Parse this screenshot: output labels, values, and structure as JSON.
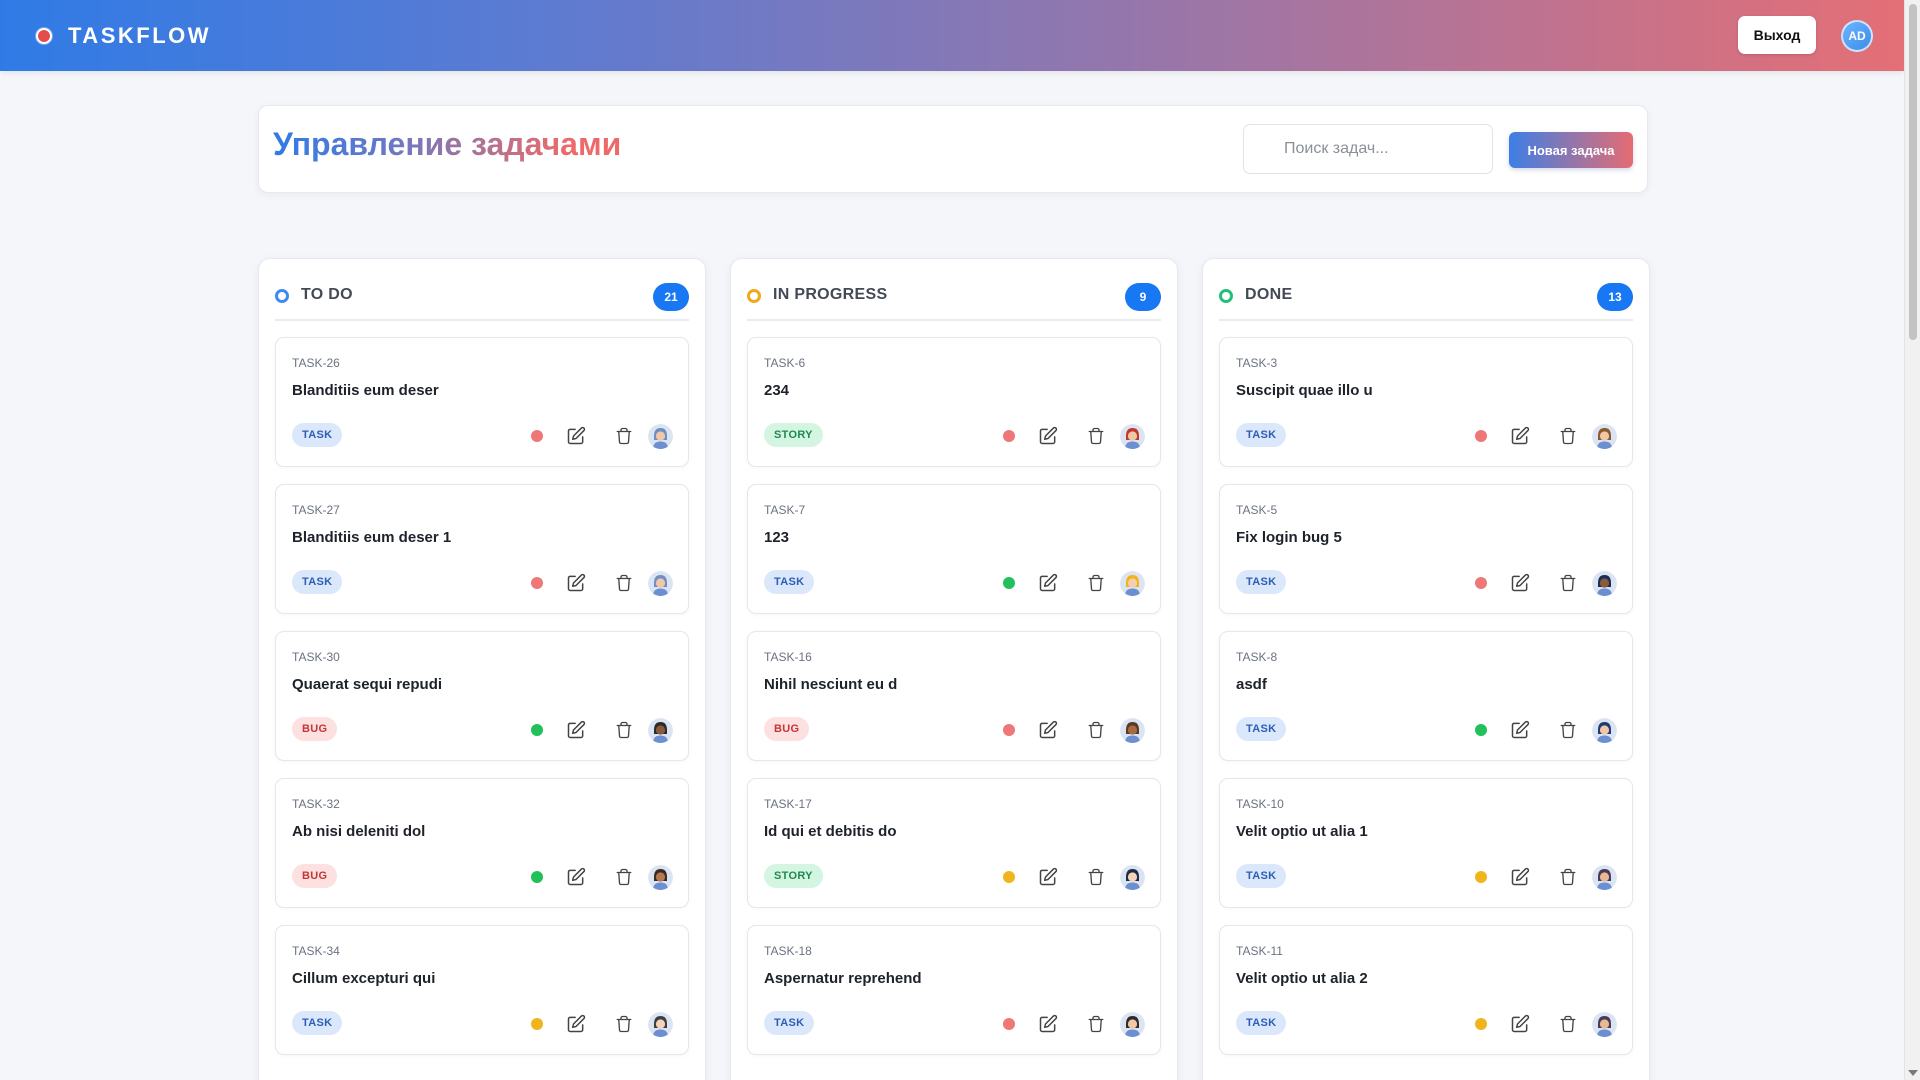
{
  "header": {
    "brand": "TASKFLOW",
    "logout_label": "Выход",
    "user_initials": "AD"
  },
  "toolbar": {
    "page_title": "Управление задачами",
    "search_placeholder": "Поиск задач...",
    "new_task_label": "Новая задача"
  },
  "colors": {
    "accent_blue": "#1877f2",
    "todo_dot": "#3d8bf0",
    "in_progress_dot": "#f0a81c",
    "done_dot": "#22c07a",
    "priority_high": "#ef7777",
    "priority_medium": "#f0b41c",
    "priority_low": "#22c05a"
  },
  "columns": [
    {
      "title": "TO DO",
      "count": "21",
      "dot_color": "#3d8bf0",
      "cards": [
        {
          "id": "TASK-26",
          "title": "Blanditiis eum deser",
          "tag": "TASK",
          "priority": "high",
          "avatar": {
            "skin": "#f2c7a5",
            "hair": "#6e8fc4"
          }
        },
        {
          "id": "TASK-27",
          "title": "Blanditiis eum deser 1",
          "tag": "TASK",
          "priority": "high",
          "avatar": {
            "skin": "#f2c7a5",
            "hair": "#6e8fc4"
          }
        },
        {
          "id": "TASK-30",
          "title": "Quaerat sequi repudi",
          "tag": "BUG",
          "priority": "low",
          "avatar": {
            "skin": "#8a5a3b",
            "hair": "#2b2b2b"
          }
        },
        {
          "id": "TASK-32",
          "title": "Ab nisi deleniti dol",
          "tag": "BUG",
          "priority": "low",
          "avatar": {
            "skin": "#b57a52",
            "hair": "#3a2a20"
          }
        },
        {
          "id": "TASK-34",
          "title": "Cillum excepturi qui",
          "tag": "TASK",
          "priority": "medium",
          "avatar": {
            "skin": "#f5d3b8",
            "hair": "#3d3d3d"
          }
        }
      ]
    },
    {
      "title": "IN PROGRESS",
      "count": "9",
      "dot_color": "#f0a81c",
      "cards": [
        {
          "id": "TASK-6",
          "title": "234",
          "tag": "STORY",
          "priority": "high",
          "avatar": {
            "skin": "#f2c7a5",
            "hair": "#c0392b"
          }
        },
        {
          "id": "TASK-7",
          "title": "123",
          "tag": "TASK",
          "priority": "low",
          "avatar": {
            "skin": "#f7cfae",
            "hair": "#f0b31c"
          }
        },
        {
          "id": "TASK-16",
          "title": "Nihil nesciunt eu d",
          "tag": "BUG",
          "priority": "high",
          "avatar": {
            "skin": "#a86a42",
            "hair": "#5a3a22"
          }
        },
        {
          "id": "TASK-17",
          "title": "Id qui et debitis do",
          "tag": "STORY",
          "priority": "medium",
          "avatar": {
            "skin": "#f5d3b8",
            "hair": "#1f2a44"
          }
        },
        {
          "id": "TASK-18",
          "title": "Aspernatur reprehend",
          "tag": "TASK",
          "priority": "high",
          "avatar": {
            "skin": "#f2c7a5",
            "hair": "#2b2b2b"
          }
        }
      ]
    },
    {
      "title": "DONE",
      "count": "13",
      "dot_color": "#22c07a",
      "cards": [
        {
          "id": "TASK-3",
          "title": "Suscipit quae illo u",
          "tag": "TASK",
          "priority": "high",
          "avatar": {
            "skin": "#f2c7a5",
            "hair": "#8a5a2b"
          }
        },
        {
          "id": "TASK-5",
          "title": "Fix login bug 5",
          "tag": "TASK",
          "priority": "high",
          "avatar": {
            "skin": "#8a5a3b",
            "hair": "#1d2d55"
          }
        },
        {
          "id": "TASK-8",
          "title": "asdf",
          "tag": "TASK",
          "priority": "low",
          "avatar": {
            "skin": "#f2c7a5",
            "hair": "#1f3b73"
          }
        },
        {
          "id": "TASK-10",
          "title": "Velit optio ut alia 1",
          "tag": "TASK",
          "priority": "medium",
          "avatar": {
            "skin": "#e8b995",
            "hair": "#4a3a55"
          }
        },
        {
          "id": "TASK-11",
          "title": "Velit optio ut alia 2",
          "tag": "TASK",
          "priority": "medium",
          "avatar": {
            "skin": "#e8b995",
            "hair": "#4a3a55"
          }
        }
      ]
    }
  ]
}
